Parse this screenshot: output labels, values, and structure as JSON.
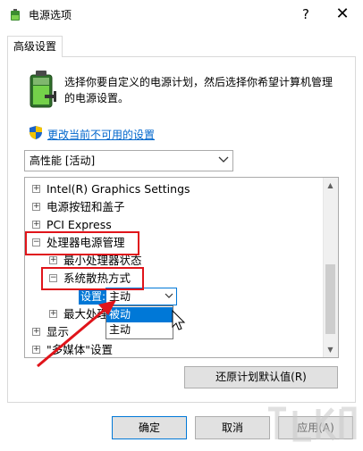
{
  "window": {
    "title": "电源选项",
    "help_glyph": "?",
    "close_glyph": "✕"
  },
  "tab": {
    "label": "高级设置"
  },
  "description": "选择你要自定义的电源计划，然后选择你希望计算机管理的电源设置。",
  "change_link": "更改当前不可用的设置",
  "plan_select": {
    "value": "高性能 [活动]"
  },
  "tree": {
    "items": [
      {
        "label": "Intel(R) Graphics Settings",
        "expander": "+"
      },
      {
        "label": "电源按钮和盖子",
        "expander": "+"
      },
      {
        "label": "PCI Express",
        "expander": "+"
      },
      {
        "label": "处理器电源管理",
        "expander": "−"
      },
      {
        "label": "最小处理器状态",
        "expander": "+"
      },
      {
        "label": "系统散热方式",
        "expander": "−"
      },
      {
        "label": "最大处理",
        "expander": "+"
      },
      {
        "label": "显示",
        "expander": "+"
      },
      {
        "label": "\"多媒体\"设置",
        "expander": "+"
      }
    ],
    "setting_label": "设置:",
    "setting_value": "主动",
    "options": [
      "被动",
      "主动"
    ]
  },
  "restore_button": "还原计划默认值(R)",
  "buttons": {
    "ok": "确定",
    "cancel": "取消",
    "apply": "应用(A)"
  },
  "colors": {
    "accent": "#0078d7",
    "link": "#0066cc",
    "highlight": "#e0141a"
  },
  "icons": {
    "app": "power-options-icon",
    "battery": "battery-plug-icon",
    "shield": "uac-shield-icon"
  }
}
